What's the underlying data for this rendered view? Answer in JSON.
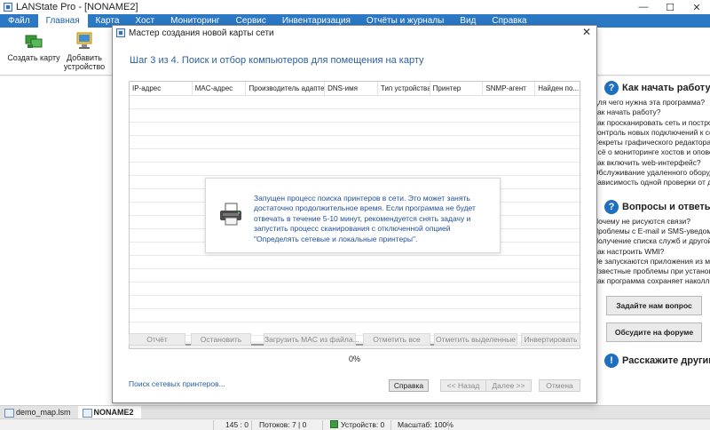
{
  "window": {
    "title": "LANState Pro - [NONAME2]",
    "controls": {
      "minimize": "—",
      "maximize": "☐",
      "close": "✕"
    }
  },
  "menu": [
    "Файл",
    "Главная",
    "Карта",
    "Хост",
    "Мониторинг",
    "Сервис",
    "Инвентаризация",
    "Отчёты и журналы",
    "Вид",
    "Справка"
  ],
  "menu_active": "Главная",
  "ribbon": {
    "create_map": "Создать карту",
    "add_device_line1": "Добавить",
    "add_device_line2": "устройство"
  },
  "dialog": {
    "title": "Мастер создания новой карты сети",
    "close": "✕",
    "step": "Шаг 3 из 4. Поиск и отбор компьютеров для помещения на карту",
    "columns": [
      "IP-адрес",
      "MAC-адрес",
      "Производитель адаптера",
      "DNS-имя",
      "Тип устройства",
      "Принтер",
      "SNMP-агент",
      "Найден по..."
    ],
    "popup_text": "Запущен процесс поиска принтеров в сети. Это может занять достаточно продолжительное время. Если программа не будет отвечать в течение 5-10 минут, рекомендуется снять задачу и запустить процесс сканирования с отключенной опцией \"Определять сетевые и локальные принтеры\".",
    "actions": {
      "report": "Отчёт",
      "stop": "Остановить",
      "load_mac": "Загрузить MAC из файла...",
      "select_all": "Отметить все",
      "select_selected": "Отметить выделенные",
      "invert": "Инвертировать"
    },
    "progress": "0%",
    "search_link": "Поиск сетевых принтеров...",
    "footer": {
      "help": "Справка",
      "back": "<< Назад",
      "next": "Далее >>",
      "cancel": "Отмена"
    }
  },
  "help_panel": {
    "section1_title": "Как начать работу?",
    "section1_links": [
      "Для чего нужна эта программа?",
      "Как начать работу?",
      "Как просканировать сеть и построить...",
      "Контроль новых подключений к сети",
      "Секреты графического редактора",
      "Всё о мониторинге хостов и оповещ...",
      "Как включить web-интерфейс?",
      "Обслуживание удаленного оборудо...",
      "Зависимость одной проверки от другой..."
    ],
    "section2_title": "Вопросы и ответы",
    "section2_links": [
      "Почему не рисуются связи?",
      "Проблемы с E-mail и SMS-уведомле...",
      "Получение списка служб и другой и...",
      "Как настроить WMI?",
      "Не запускаются приложения из мен...",
      "Известные проблемы при установке...",
      "Как программа сохраняет наколле..."
    ],
    "ask_button": "Задайте нам вопрос",
    "forum_button": "Обсудите на форуме",
    "section3_title": "Расскажите другим!"
  },
  "doc_tabs": [
    "demo_map.lsm",
    "NONAME2"
  ],
  "doc_tab_active": "NONAME2",
  "status": {
    "coords": "145 : 0",
    "threads": "Потоков: 7 | 0",
    "devices": "Устройств: 0",
    "zoom": "Масштаб: 100%"
  },
  "colors": {
    "menu_bg": "#2b78c4",
    "link": "#2a5fa6",
    "popup_text": "#1f4f9a",
    "help_icon": "#1f6fc1"
  }
}
